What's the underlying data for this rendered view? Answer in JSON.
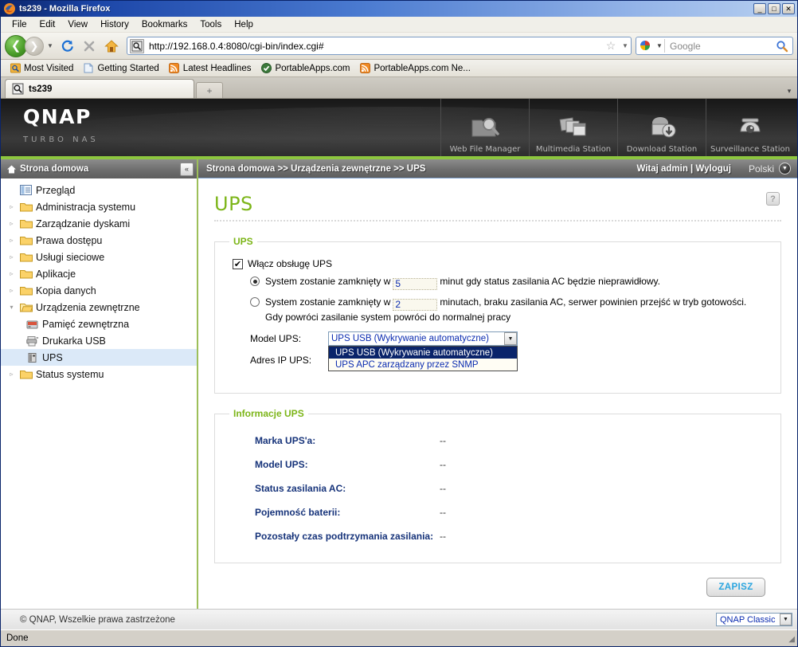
{
  "browser": {
    "window_title": "ts239 - Mozilla Firefox",
    "window_buttons": {
      "minimize": "_",
      "maximize": "□",
      "close": "✕"
    },
    "menus": [
      "File",
      "Edit",
      "View",
      "History",
      "Bookmarks",
      "Tools",
      "Help"
    ],
    "nav": {
      "back_icon": "back-arrow-icon",
      "forward_icon": "forward-arrow-icon",
      "dropdown_icon": "chevron-down-icon",
      "reload_icon": "reload-icon",
      "stop_icon": "stop-icon",
      "home_icon": "home-icon"
    },
    "url": "http://192.168.0.4:8080/cgi-bin/index.cgi#",
    "search_engine": "Google",
    "bookmarks": [
      {
        "label": "Most Visited",
        "icon": "most-visited-icon"
      },
      {
        "label": "Getting Started",
        "icon": "page-icon"
      },
      {
        "label": "Latest Headlines",
        "icon": "rss-icon"
      },
      {
        "label": "PortableApps.com",
        "icon": "portableapps-icon"
      },
      {
        "label": "PortableApps.com Ne...",
        "icon": "rss-icon"
      }
    ],
    "tabs": [
      {
        "label": "ts239"
      }
    ],
    "new_tab_label": "+",
    "tab_list_chevron": "▾",
    "status": "Done"
  },
  "banner": {
    "logo": "QNAP",
    "tagline": "TURBO NAS",
    "apps": [
      {
        "label": "Web File Manager",
        "icon": "web-file-manager-icon"
      },
      {
        "label": "Multimedia Station",
        "icon": "multimedia-station-icon"
      },
      {
        "label": "Download Station",
        "icon": "download-station-icon"
      },
      {
        "label": "Surveillance Station",
        "icon": "surveillance-station-icon"
      }
    ]
  },
  "subbar": {
    "home_label": "Strona domowa",
    "collapse_icon": "«",
    "breadcrumb": "Strona domowa >> Urządzenia zewnętrzne >> UPS",
    "welcome": "Witaj admin | Wyloguj",
    "language": "Polski"
  },
  "sidebar": {
    "items": [
      {
        "label": "Przegląd",
        "level": 1,
        "arrow": "",
        "icon": "overview-icon",
        "selected": false
      },
      {
        "label": "Administracja systemu",
        "level": 1,
        "arrow": "▹",
        "icon": "folder-icon",
        "selected": false
      },
      {
        "label": "Zarządzanie dyskami",
        "level": 1,
        "arrow": "▹",
        "icon": "folder-icon",
        "selected": false
      },
      {
        "label": "Prawa dostępu",
        "level": 1,
        "arrow": "▹",
        "icon": "folder-icon",
        "selected": false
      },
      {
        "label": "Usługi sieciowe",
        "level": 1,
        "arrow": "▹",
        "icon": "folder-icon",
        "selected": false
      },
      {
        "label": "Aplikacje",
        "level": 1,
        "arrow": "▹",
        "icon": "folder-icon",
        "selected": false
      },
      {
        "label": "Kopia danych",
        "level": 1,
        "arrow": "▹",
        "icon": "folder-icon",
        "selected": false
      },
      {
        "label": "Urządzenia zewnętrzne",
        "level": 1,
        "arrow": "▾",
        "icon": "folder-open-icon",
        "selected": false
      },
      {
        "label": "Pamięć zewnętrzna",
        "level": 2,
        "arrow": "",
        "icon": "external-storage-icon",
        "selected": false
      },
      {
        "label": "Drukarka USB",
        "level": 2,
        "arrow": "",
        "icon": "usb-printer-icon",
        "selected": false
      },
      {
        "label": "UPS",
        "level": 2,
        "arrow": "",
        "icon": "ups-icon",
        "selected": true
      },
      {
        "label": "Status systemu",
        "level": 1,
        "arrow": "▹",
        "icon": "folder-icon",
        "selected": false
      }
    ]
  },
  "main": {
    "title": "UPS",
    "help_icon": "?",
    "ups_box": {
      "legend": "UPS",
      "enable_checkbox": {
        "label": "Włącz obsługę UPS",
        "checked": true,
        "mark": "✔"
      },
      "option1": {
        "selected": true,
        "text_before": "System zostanie zamknięty w",
        "value": "5",
        "text_after": "minut gdy status zasilania AC będzie nieprawidłowy."
      },
      "option2": {
        "selected": false,
        "text_before": "System zostanie zamknięty w",
        "value": "2",
        "text_after": "minutach, braku zasilania AC, serwer powinien przejść w tryb gotowości.",
        "text_line2": "Gdy powróci zasilanie system powróci do normalnej pracy"
      },
      "model_label": "Model UPS:",
      "model_value": "UPS USB (Wykrywanie automatyczne)",
      "model_options": [
        "UPS USB (Wykrywanie automatyczne)",
        "UPS APC zarządzany przez SNMP"
      ],
      "model_selected_index": 0,
      "ip_label": "Adres IP UPS:"
    },
    "info_box": {
      "legend": "Informacje UPS",
      "rows": [
        {
          "label": "Marka UPS'a:",
          "value": "--"
        },
        {
          "label": "Model UPS:",
          "value": "--"
        },
        {
          "label": "Status zasilania AC:",
          "value": "--"
        },
        {
          "label": "Pojemność baterii:",
          "value": "--"
        },
        {
          "label": "Pozostały czas podtrzymania zasilania:",
          "value": "--"
        }
      ]
    },
    "save_button": "ZAPISZ"
  },
  "footer": {
    "copyright": "© QNAP, Wszelkie prawa zastrzeżone",
    "skin": "QNAP Classic"
  },
  "colors": {
    "qnap_green": "#8dc63f",
    "title_green": "#7cb518",
    "info_label_blue": "#16337a",
    "select_highlight": "#0a246a",
    "save_text": "#2ba6e0"
  }
}
